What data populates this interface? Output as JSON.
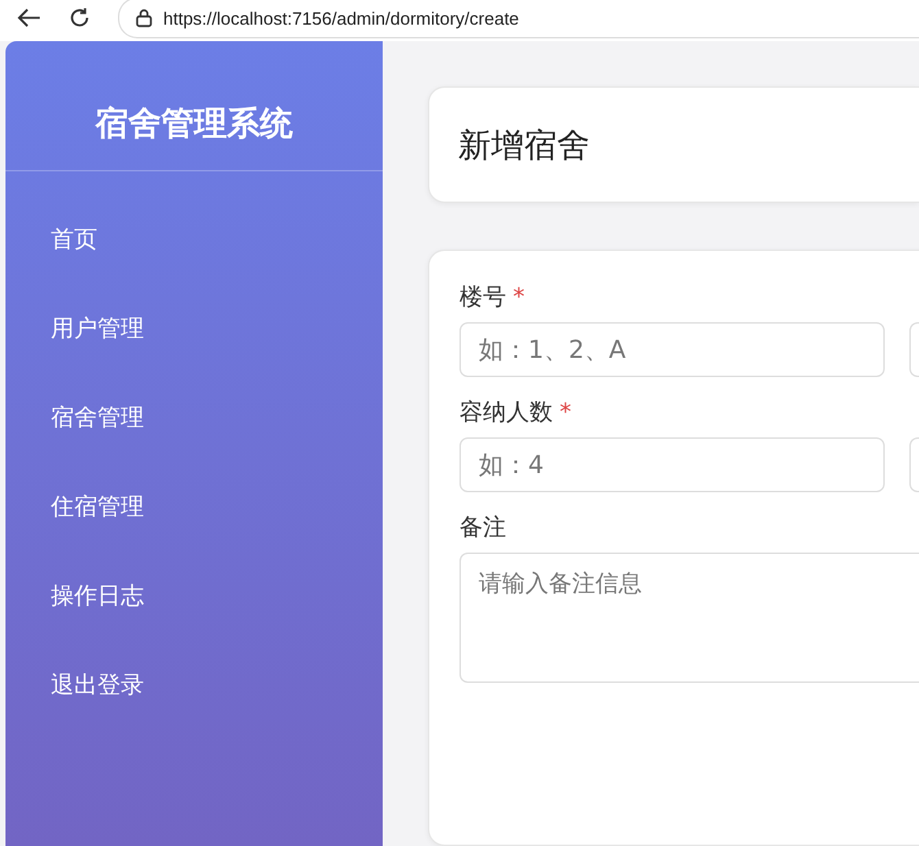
{
  "browser": {
    "url": "https://localhost:7156/admin/dormitory/create"
  },
  "sidebar": {
    "title": "宿舍管理系统",
    "items": [
      {
        "label": "首页"
      },
      {
        "label": "用户管理"
      },
      {
        "label": "宿舍管理"
      },
      {
        "label": "住宿管理"
      },
      {
        "label": "操作日志"
      },
      {
        "label": "退出登录"
      }
    ]
  },
  "header": {
    "title": "新增宿舍"
  },
  "form": {
    "rows": [
      {
        "label": "楼号",
        "required_mark": "*",
        "placeholder": "如：1、2、A"
      },
      {
        "label": "容纳人数",
        "required_mark": "*",
        "placeholder": "如：4"
      }
    ],
    "remark": {
      "label": "备注",
      "placeholder": "请输入备注信息"
    }
  }
}
